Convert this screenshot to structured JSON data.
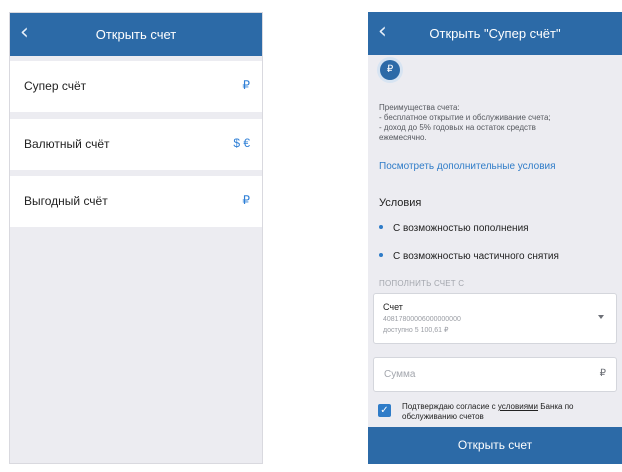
{
  "left_screen": {
    "header": {
      "back_icon": "chevron-left",
      "title": "Открыть счет"
    },
    "accounts": [
      {
        "name": "Супер счёт",
        "currency": "₽"
      },
      {
        "name": "Валютный счёт",
        "currency": "$ €"
      },
      {
        "name": "Выгодный счёт",
        "currency": "₽"
      }
    ]
  },
  "right_screen": {
    "header": {
      "back_icon": "chevron-left",
      "title": "Открыть \"Супер счёт\""
    },
    "coin_symbol": "₽",
    "benefits": [
      "Преимущества счета:",
      "- бесплатное открытие и обслуживание счета;",
      "- доход до 5% годовых на остаток средств",
      "ежемесячно."
    ],
    "more_link": "Посмотреть дополнительные условия",
    "conditions_title": "Условия",
    "conditions": [
      "С возможностью пополнения",
      "С возможностью частичного снятия"
    ],
    "fund_label": "ПОПОЛНИТЬ СЧЕТ С",
    "account": {
      "title": "Счет",
      "number": "40817800006000000000",
      "balance": "доступно 5 100,61 ₽"
    },
    "sum": {
      "placeholder": "Сумма",
      "currency": "₽"
    },
    "agree": {
      "checked": true,
      "text_before": "Подтверждаю согласие с ",
      "link": "условиями",
      "text_after": " Банка по обслуживанию счетов"
    },
    "open_button": "Открыть счет"
  },
  "colors": {
    "header": "#2c6aa7",
    "accent": "#2f7cc8",
    "background": "#ececf1"
  }
}
